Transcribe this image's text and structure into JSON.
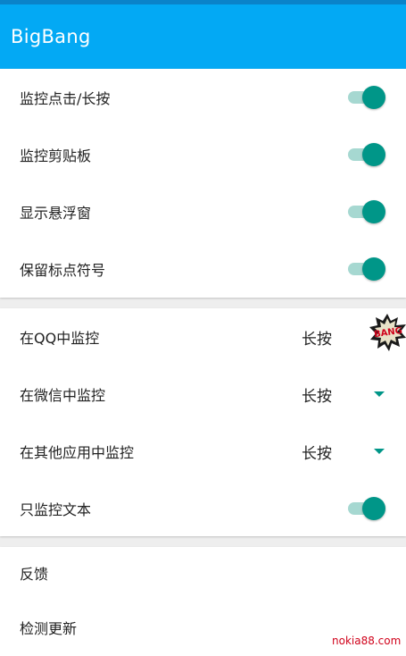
{
  "app": {
    "title": "BigBang"
  },
  "toggles": [
    {
      "label": "监控点击/长按",
      "on": true
    },
    {
      "label": "监控剪贴板",
      "on": true
    },
    {
      "label": "显示悬浮窗",
      "on": true
    },
    {
      "label": "保留标点符号",
      "on": true
    }
  ],
  "monitor": {
    "qq": {
      "label": "在QQ中监控",
      "value": "长按"
    },
    "wechat": {
      "label": "在微信中监控",
      "value": "长按"
    },
    "other": {
      "label": "在其他应用中监控",
      "value": "长按"
    },
    "text_only": {
      "label": "只监控文本",
      "on": true
    }
  },
  "misc": {
    "feedback": "反馈",
    "check_update": "检测更新"
  },
  "badge": {
    "text": "BANG"
  },
  "watermark": "nokia88.com",
  "colors": {
    "appbar": "#03a9f4",
    "accent": "#009688",
    "track": "#a6d8d1"
  }
}
